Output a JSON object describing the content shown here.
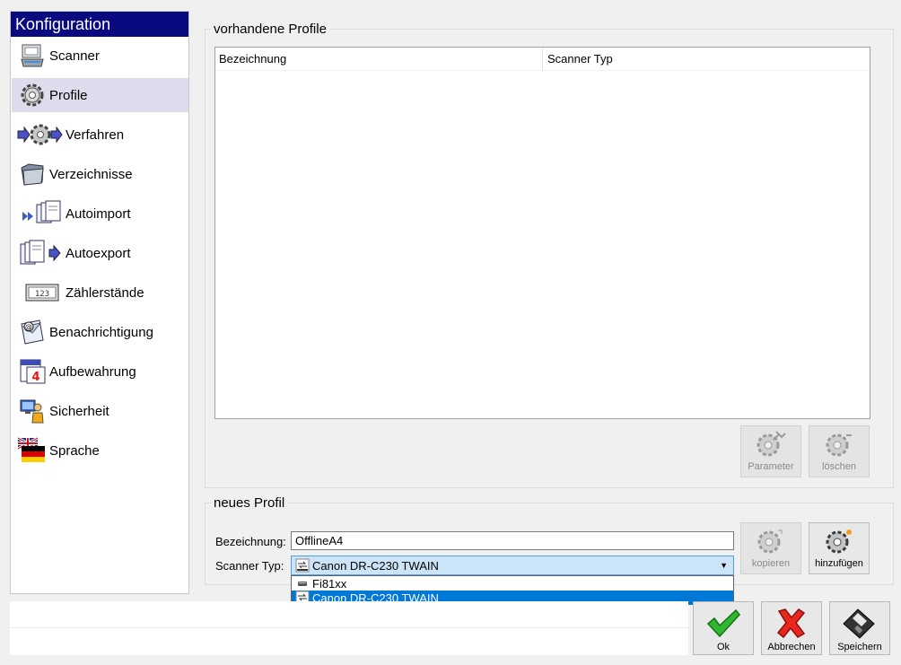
{
  "sidebar": {
    "title": "Konfiguration",
    "items": [
      {
        "label": "Scanner",
        "icon": "scanner-icon"
      },
      {
        "label": "Profile",
        "icon": "gear-icon",
        "active": true
      },
      {
        "label": "Verfahren",
        "icon": "process-gear-icon"
      },
      {
        "label": "Verzeichnisse",
        "icon": "folder-icon"
      },
      {
        "label": "Autoimport",
        "icon": "import-documents-icon"
      },
      {
        "label": "Autoexport",
        "icon": "export-documents-icon"
      },
      {
        "label": "Zählerstände",
        "icon": "counter-icon"
      },
      {
        "label": "Benachrichtigung",
        "icon": "email-icon"
      },
      {
        "label": "Aufbewahrung",
        "icon": "calendar-icon"
      },
      {
        "label": "Sicherheit",
        "icon": "security-user-icon"
      },
      {
        "label": "Sprache",
        "icon": "flag-icon"
      }
    ]
  },
  "existing_profiles": {
    "legend": "vorhandene Profile",
    "columns": [
      "Bezeichnung",
      "Scanner Typ"
    ],
    "rows": [],
    "buttons": {
      "parameter": "Parameter",
      "delete": "löschen"
    }
  },
  "new_profile": {
    "legend": "neues Profil",
    "name_label": "Bezeichnung:",
    "name_value": "OfflineA4",
    "scanner_label": "Scanner Typ:",
    "scanner_value": "Canon DR-C230 TWAIN",
    "scanner_options": [
      "Fi81xx",
      "Canon DR-C230 TWAIN"
    ],
    "buttons": {
      "copy": "kopieren",
      "add": "hinzufügen"
    }
  },
  "footer": {
    "ok": "Ok",
    "cancel": "Abbrechen",
    "save": "Speichern"
  },
  "colors": {
    "title_bar": "#0a0a80",
    "selection": "#0078d7",
    "active_item": "#dcdcec",
    "ok_check": "#2eb82e",
    "cancel_x": "#e8261d"
  }
}
